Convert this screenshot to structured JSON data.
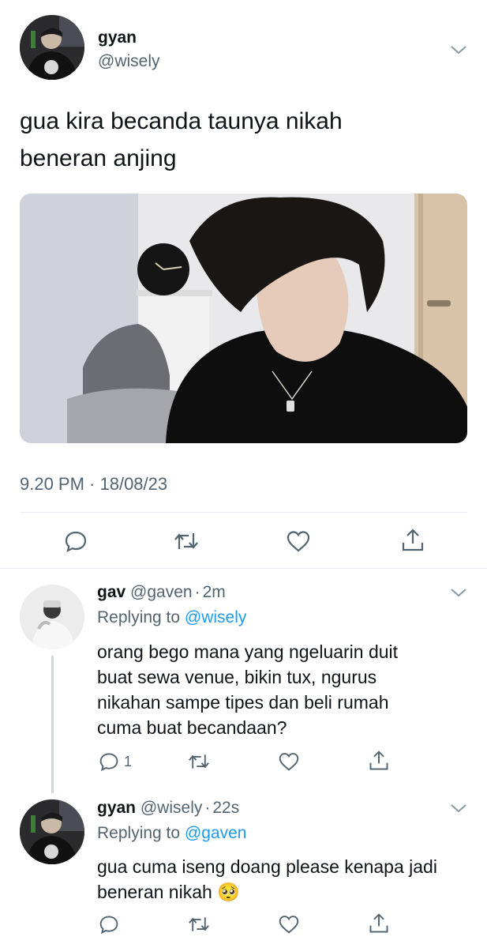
{
  "tweet": {
    "display_name": "gyan",
    "handle": "@wisely",
    "text_line1": "gua kira becanda taunya nikah",
    "text_line2": "beneran anjing",
    "timestamp": "9.20 PM · 18/08/23",
    "actions": [
      "reply-icon",
      "retweet-icon",
      "like-icon",
      "share-icon"
    ]
  },
  "replies": [
    {
      "display_name": "gav",
      "handle": "@gaven",
      "sep": "·",
      "time": "2m",
      "replying_prefix": "Replying to",
      "replying_to": "@wisely",
      "lines": [
        "orang bego mana yang ngeluarin duit",
        "buat sewa venue, bikin tux, ngurus",
        "nikahan sampe tipes dan beli rumah",
        "cuma buat becandaan?"
      ],
      "reply_count": "1"
    },
    {
      "display_name": "gyan",
      "handle": "@wisely",
      "sep": "·",
      "time": "22s",
      "replying_prefix": "Replying to",
      "replying_to": "@gaven",
      "lines": [
        "gua cuma iseng doang please kenapa jadi",
        "beneran nikah"
      ],
      "emoji": "🥺"
    }
  ],
  "colors": {
    "accent": "#1d9bf0",
    "secondary_text": "#536471",
    "divider": "#e6ecf0"
  }
}
